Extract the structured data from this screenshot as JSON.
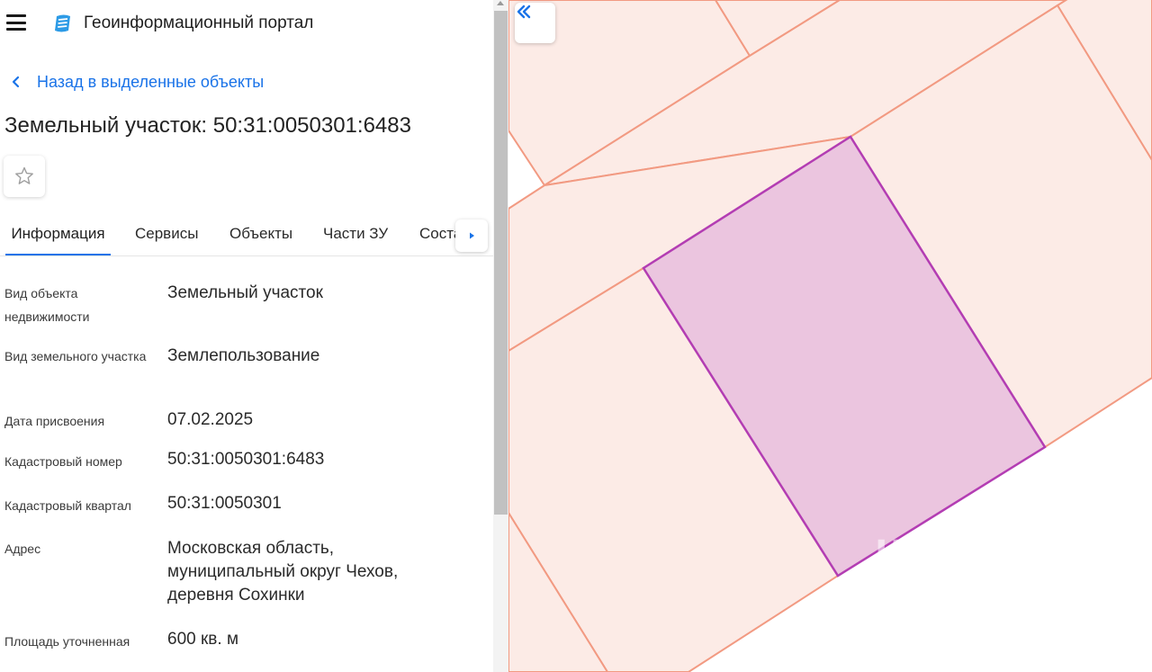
{
  "header": {
    "portal_title": "Геоинформационный портал",
    "menu_icon": "hamburger-icon",
    "logo_icon": "portal-logo-icon"
  },
  "back_link": {
    "label": "Назад в выделенные объекты",
    "icon": "chevron-left-icon"
  },
  "object_title": "Земельный участок: 50:31:0050301:6483",
  "favorite": {
    "icon": "star-icon"
  },
  "tabs": [
    {
      "label": "Информация",
      "active": true
    },
    {
      "label": "Сервисы",
      "active": false
    },
    {
      "label": "Объекты",
      "active": false
    },
    {
      "label": "Части ЗУ",
      "active": false
    },
    {
      "label": "Соста",
      "active": false
    }
  ],
  "tabs_next_icon": "caret-right-icon",
  "properties": [
    {
      "label": "Вид объекта недвижимости",
      "value": "Земельный участок"
    },
    {
      "label": "Вид земельного участка",
      "value": "Землепользование"
    },
    {
      "label": "Дата присвоения",
      "value": "07.02.2025"
    },
    {
      "label": "Кадастровый номер",
      "value": "50:31:0050301:6483"
    },
    {
      "label": "Кадастровый квартал",
      "value": "50:31:0050301"
    },
    {
      "label": "Адрес",
      "value": "Московская область, муниципальный округ Чехов, деревня Сохинки"
    },
    {
      "label": "Площадь уточненная",
      "value": "600 кв. м"
    }
  ],
  "map": {
    "collapse_icon": "double-chevron-left-icon",
    "watermark": "циан",
    "colors": {
      "parcel_fill": "#fcebe6",
      "parcel_border": "#f29a82",
      "selected_fill": "#ebc5df",
      "selected_border": "#b33db3"
    }
  },
  "colors": {
    "accent": "#1a73e8",
    "text": "#222222"
  }
}
